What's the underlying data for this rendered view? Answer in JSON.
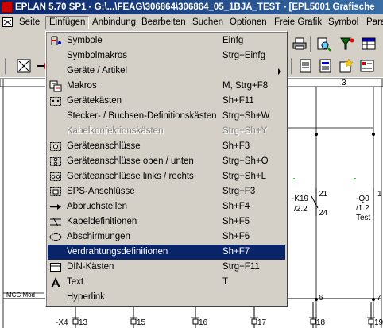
{
  "window": {
    "title": "EPLAN 5.70 SP1 - G:\\...\\FEAG\\306864\\306864_05_1BJA_TEST - [EPL5001 Grafische"
  },
  "menubar": {
    "items": [
      {
        "label": "Seite"
      },
      {
        "label": "Einfügen"
      },
      {
        "label": "Anbindung"
      },
      {
        "label": "Bearbeiten"
      },
      {
        "label": "Suchen"
      },
      {
        "label": "Optionen"
      },
      {
        "label": "Freie Grafik"
      },
      {
        "label": "Symbol"
      },
      {
        "label": "Para"
      }
    ],
    "open_menu": "Einfügen"
  },
  "dropdown": {
    "items": [
      {
        "label": "Symbole",
        "shortcut": "Einfg",
        "icon": "symbol-icon"
      },
      {
        "label": "Symbolmakros",
        "shortcut": "Strg+Einfg",
        "icon": ""
      },
      {
        "label": "Geräte / Artikel",
        "shortcut": "",
        "icon": "",
        "submenu": true
      },
      {
        "label": "Makros",
        "shortcut": "M, Strg+F8",
        "icon": "macro-icon"
      },
      {
        "label": "Gerätekästen",
        "shortcut": "Sh+F11",
        "icon": "device-box-icon"
      },
      {
        "label": "Stecker- / Buchsen-Definitionskästen",
        "shortcut": "Strg+Sh+W",
        "icon": ""
      },
      {
        "label": "Kabelkonfektionskästen",
        "shortcut": "Strg+Sh+Y",
        "icon": "",
        "disabled": true
      },
      {
        "label": "Geräteanschlüsse",
        "shortcut": "Sh+F3",
        "icon": "device-connection-icon"
      },
      {
        "label": "Geräteanschlüsse oben / unten",
        "shortcut": "Strg+Sh+O",
        "icon": "device-connection-top-bottom-icon"
      },
      {
        "label": "Geräteanschlüsse links / rechts",
        "shortcut": "Strg+Sh+L",
        "icon": "device-connection-left-right-icon"
      },
      {
        "label": "SPS-Anschlüsse",
        "shortcut": "Strg+F3",
        "icon": "plc-connection-icon"
      },
      {
        "label": "Abbruchstellen",
        "shortcut": "Sh+F4",
        "icon": "interruption-point-icon"
      },
      {
        "label": "Kabeldefinitionen",
        "shortcut": "Sh+F5",
        "icon": "cable-definition-icon"
      },
      {
        "label": "Abschirmungen",
        "shortcut": "Sh+F6",
        "icon": "shield-icon"
      },
      {
        "label": "Verdrahtungsdefinitionen",
        "shortcut": "Sh+F7",
        "icon": "",
        "selected": true
      },
      {
        "label": "DIN-Kästen",
        "shortcut": "Strg+F11",
        "icon": "din-box-icon"
      },
      {
        "label": "Text",
        "shortcut": "T",
        "icon": "text-icon"
      },
      {
        "label": "Hyperlink",
        "shortcut": "",
        "icon": ""
      }
    ]
  },
  "schematic": {
    "ruler_number": "3",
    "left_label": "MCC Mod",
    "device_k19": {
      "name": "-K19",
      "ref": "/2.2",
      "pin_top": "21",
      "pin_bottom": "24"
    },
    "device_q0": {
      "name": "-Q0",
      "ref": "/1.2",
      "desc": "Test",
      "pin_top": "1"
    },
    "right_pins": [
      "6",
      "7"
    ],
    "terminal_strip": {
      "name": "-X4",
      "terminals": [
        "13",
        "15",
        "16",
        "17",
        "18",
        "19"
      ]
    }
  },
  "colors": {
    "title_start": "#0a246a",
    "title_end": "#3a6ea5",
    "selection": "#0a246a",
    "ui_face": "#d4d0c8"
  }
}
